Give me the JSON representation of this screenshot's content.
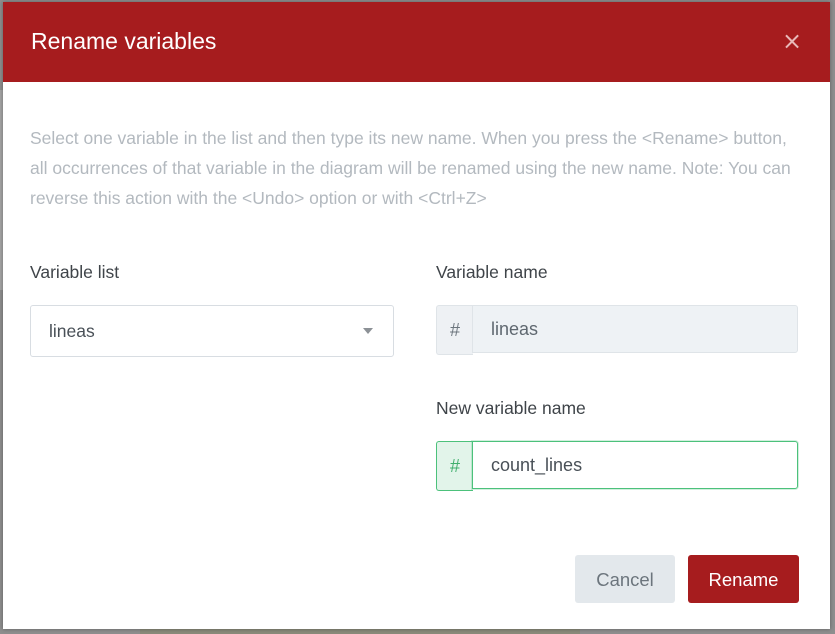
{
  "dialog": {
    "title": "Rename variables",
    "close_glyph": "×",
    "description": "Select one variable in the list and then type its new name. When you press the <Rename> button, all occurrences of that variable in the diagram will be renamed using the new name. Note: You can reverse this action with the <Undo> option or with <Ctrl+Z>"
  },
  "variable_list": {
    "label": "Variable list",
    "selected": "lineas"
  },
  "variable_name": {
    "label": "Variable name",
    "prefix": "#",
    "value": "lineas"
  },
  "new_variable_name": {
    "label": "New variable name",
    "prefix": "#",
    "value": "count_lines"
  },
  "buttons": {
    "cancel": "Cancel",
    "rename": "Rename"
  },
  "colors": {
    "header": "#a61c1e",
    "primary_button": "#a61c1e",
    "valid_field_border": "#4cc17b"
  },
  "icons": {
    "close": "close-icon",
    "dropdown": "caret-down-icon"
  }
}
